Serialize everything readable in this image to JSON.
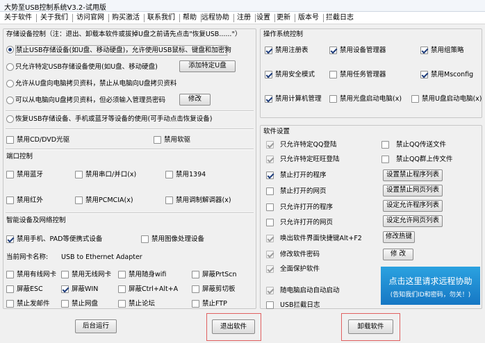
{
  "window": {
    "title": "大势至USB控制系统V3.2-试用版"
  },
  "menu": [
    "关于软件",
    "关于我们",
    "访问官网",
    "购买激活",
    "联系我们",
    "帮助",
    "远程协助",
    "注册",
    "设置",
    "更新",
    "版本号",
    "拦截日志"
  ],
  "storage": {
    "title": "存储设备控制（注：退出、卸载本软件或拔掉U盘之前请先点击\"恢复USB......\"）",
    "options": [
      "禁止USB存储设备(如U盘、移动硬盘)，允许使用USB鼠标、键盘和加密狗",
      "只允许特定USB存储设备使用(如U盘、移动硬盘)",
      "允许从U盘向电脑拷贝资料，禁止从电脑向U盘拷贝资料",
      "可以从电脑向U盘拷贝资料，但必须输入管理员密码",
      "恢复USB存储设备、手机或蓝牙等设备的使用(可手动点击恢复设备)"
    ],
    "add_button": "添加特定U盘",
    "modify_button": "修改",
    "cd_label": "禁用CD/DVD光驱",
    "floppy_label": "禁用软驱"
  },
  "port": {
    "title": "端口控制",
    "items": [
      "禁用蓝牙",
      "禁用串口/并口(x)",
      "禁用1394",
      "禁用红外",
      "禁用PCMCIA(x)",
      "禁用调制解调器(x)"
    ]
  },
  "smart": {
    "title": "智能设备及网络控制",
    "phone_label": "禁用手机、PAD等便携式设备",
    "image_label": "禁用图像处理设备",
    "nic_label": "当前网卡名称:",
    "nic_value": "USB to Ethernet Adapter",
    "net_items": [
      "禁用有线网卡",
      "禁用无线网卡",
      "禁用随身wifi",
      "屏蔽PrtScn",
      "屏蔽ESC",
      "屏蔽WIN",
      "屏蔽Ctrl+Alt+A",
      "屏蔽剪切板",
      "禁止发邮件",
      "禁止网盘",
      "禁止论坛",
      "禁止FTP"
    ]
  },
  "os": {
    "title": "操作系统控制",
    "items": [
      "禁用注册表",
      "禁用设备管理器",
      "禁用组策略",
      "禁用安全模式",
      "禁用任务管理器",
      "禁用Msconfig",
      "禁用计算机管理",
      "禁用光盘启动电脑(x)",
      "禁用U盘启动电脑(x)"
    ]
  },
  "software": {
    "title": "软件设置",
    "items": [
      "只允许特定QQ登陆",
      "禁止QQ传送文件",
      "只允许特定旺旺登陆",
      "禁止QQ群上传文件",
      "禁止打开的程序",
      "禁止打开的网页",
      "只允许打开的程序",
      "只允许打开的网页",
      "唤出软件界面快捷键Alt+F2",
      "修改软件密码",
      "全面保护软件",
      "随电脑启动自动启动",
      "USB拦截日志"
    ],
    "buttons": [
      "设置禁止程序列表",
      "设置禁止网页列表",
      "设定允许程序列表",
      "设定允许网页列表",
      "修改热键",
      "修 改"
    ]
  },
  "promo": {
    "line1": "点击这里请求远程协助",
    "line2": "(告知我们ID和密码，勿关！)"
  },
  "bottom": {
    "background_run": "后台运行",
    "exit": "退出软件",
    "uninstall": "卸载软件"
  }
}
